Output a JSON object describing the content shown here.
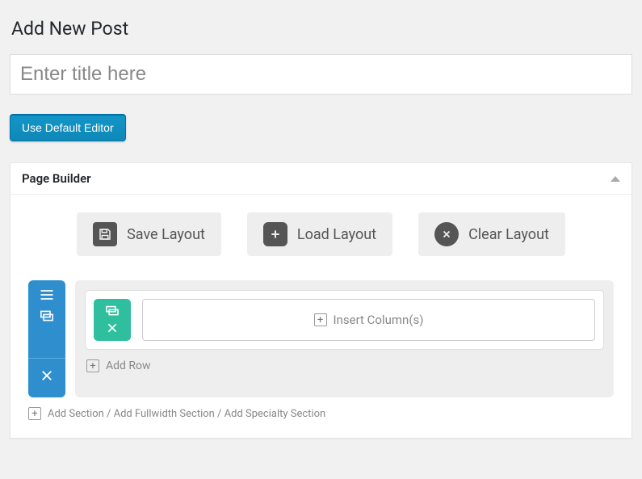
{
  "page": {
    "heading": "Add New Post",
    "title_placeholder": "Enter title here"
  },
  "actions": {
    "default_editor_label": "Use Default Editor"
  },
  "metabox": {
    "title": "Page Builder"
  },
  "layout_buttons": {
    "save": "Save Layout",
    "load": "Load Layout",
    "clear": "Clear Layout"
  },
  "builder": {
    "insert_columns_label": "Insert Column(s)",
    "add_row_label": "Add Row",
    "add_section_label": "Add Section / Add Fullwidth Section / Add Specialty Section"
  }
}
